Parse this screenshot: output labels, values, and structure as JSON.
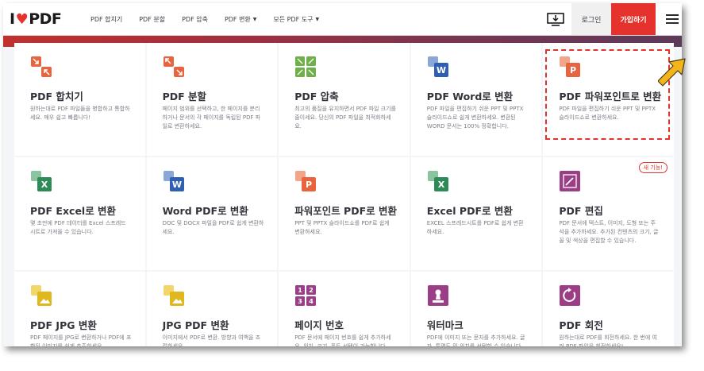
{
  "header": {
    "logo_i": "I",
    "logo_heart": "♥",
    "logo_pdf": "PDF",
    "nav": [
      {
        "label": "PDF 합치기",
        "caret": ""
      },
      {
        "label": "PDF 분할",
        "caret": ""
      },
      {
        "label": "PDF 압축",
        "caret": ""
      },
      {
        "label": "PDF 변환",
        "caret": "▼"
      },
      {
        "label": "모든 PDF 도구",
        "caret": "▼"
      }
    ],
    "login": "로그인",
    "signup": "가입하기"
  },
  "tools": [
    {
      "title": "PDF 합치기",
      "desc": "원하는대로 PDF 파일들을 병합하고 통합하세요. 매우 쉽고 빠릅니다!",
      "icon": "merge-icon",
      "color": "#e8643f"
    },
    {
      "title": "PDF 분할",
      "desc": "페이지 범위를 선택하고, 한 페이지를 분리하거나 문서의 각 페이지를 독립된 PDF 파일로 변환하세요.",
      "icon": "split-icon",
      "color": "#e8643f"
    },
    {
      "title": "PDF 압축",
      "desc": "최고의 품질을 유지하면서 PDF 파일 크기를 줄이세요. 당신의 PDF 파일을 최적화하세요.",
      "icon": "compress-icon",
      "color": "#6fb04b"
    },
    {
      "title": "PDF Word로 변환",
      "desc": "PDF 파일을 편집하기 쉬운 PPT 및 PPTX 슬라이드쇼로 쉽게 변환하세요. 변환된 WORD 문서는 100% 정확합니다.",
      "icon": "word-icon",
      "color": "#2f5fb3"
    },
    {
      "title": "PDF 파워포인트로 변환",
      "desc": "PDF 파일을 편집하기 쉬운 PPT 및 PPTX 슬라이드쇼로 변환하세요.",
      "icon": "powerpoint-icon",
      "color": "#e8643f"
    },
    {
      "title": "PDF Excel로 변환",
      "desc": "몇 초만에 PDF 데이터를 Excel 스프레드 시트로 가져올 수 있습니다.",
      "icon": "excel-icon",
      "color": "#2e8b57"
    },
    {
      "title": "Word PDF로 변환",
      "desc": "DOC 및 DOCX 파일을 PDF로 쉽게 변환하세요.",
      "icon": "word-icon",
      "color": "#2f5fb3"
    },
    {
      "title": "파워포인트 PDF로 변환",
      "desc": "PPT 및 PPTX 슬라이드쇼를 PDF로 쉽게 변환하세요.",
      "icon": "powerpoint-icon",
      "color": "#e8643f"
    },
    {
      "title": "Excel PDF로 변환",
      "desc": "EXCEL 스프레드시트를 PDF로 쉽게 변환하세요.",
      "icon": "excel-icon",
      "color": "#2e8b57"
    },
    {
      "title": "PDF 편집",
      "desc": "PDF 문서에 텍스트, 이미지, 도형 또는 주석을 추가하세요. 추가된 컨텐츠의 크기, 글꼴 및 색상을 편집할 수 있습니다.",
      "icon": "edit-icon",
      "color": "#9b3e86",
      "badge": "새 기능!"
    },
    {
      "title": "PDF JPG 변환",
      "desc": "PDF 페이지를 JPG로 변환하거나 PDF에 포함된 이미지를 쉽게 추출하세요.",
      "icon": "jpg-icon",
      "color": "#e0b81e"
    },
    {
      "title": "JPG PDF 변환",
      "desc": "이미지에서 PDF로 변환. 방향과 여백을 조절하세요.",
      "icon": "jpg-icon",
      "color": "#e0b81e"
    },
    {
      "title": "페이지 번호",
      "desc": "PDF 문서에 페이지 번호를 쉽게 추가하세요. 위치, 크기, 폰트 선택이 가능합니다.",
      "icon": "page-numbers-icon",
      "color": "#9b3e86"
    },
    {
      "title": "워터마크",
      "desc": "PDF에 이미지 또는 문자를 추가하세요. 글자, 투명도 및 위치를 선택할 수 있습니다.",
      "icon": "watermark-icon",
      "color": "#9b3e86"
    },
    {
      "title": "PDF 회전",
      "desc": "원하는대로 PDF를 회전하세요. 한 번에 여러 PDF 파일을 회전하세요!",
      "icon": "rotate-icon",
      "color": "#9b3e86"
    }
  ]
}
